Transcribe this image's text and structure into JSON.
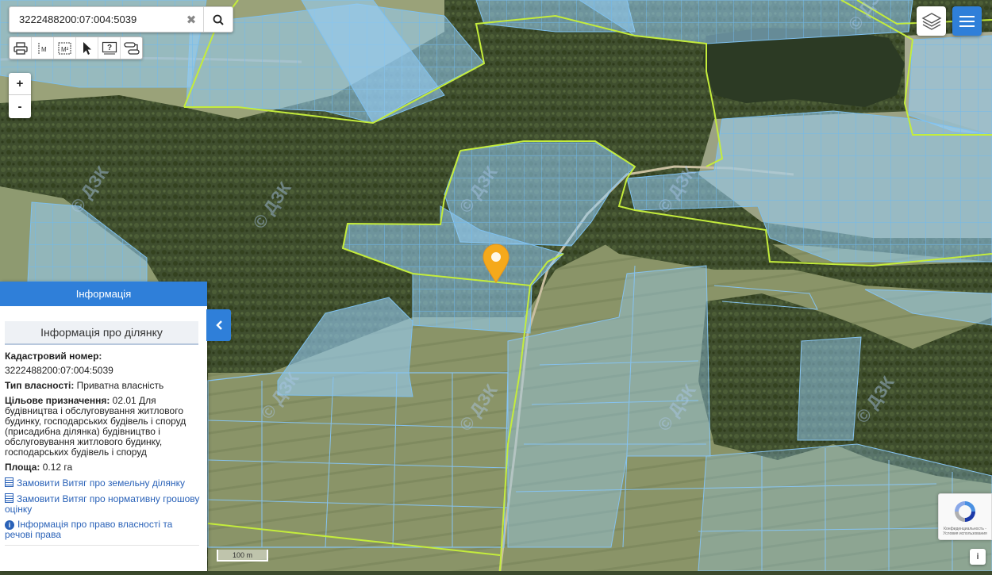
{
  "search": {
    "value": "3222488200:07:004:5039",
    "clear_icon": "close-icon",
    "search_icon": "search-icon"
  },
  "toolbar": {
    "tools": [
      "print-icon",
      "measure-length-icon",
      "measure-area-icon",
      "pointer-icon",
      "identify-icon",
      "route-icon"
    ],
    "tool_labels": [
      "M",
      "M²"
    ]
  },
  "zoom": {
    "in": "+",
    "out": "-"
  },
  "map": {
    "watermark": "© ДЗК",
    "scale": "100 m",
    "accent": "#2f7fd9",
    "parcel_fill": "#8ec5f2",
    "boundary": "#c4ec3c",
    "marker": "#f5a91b"
  },
  "panel": {
    "header": "Інформація",
    "subtitle": "Інформація про ділянку",
    "cadastral_label": "Кадастровий номер:",
    "cadastral_value": "3222488200:07:004:5039",
    "ownership_label": "Тип власності:",
    "ownership_value": " Приватна власність",
    "purpose_label": "Цільове призначення:",
    "purpose_value": " 02.01 Для будівництва і обслуговування житлового будинку, господарських будівель і споруд (присадибна ділянка) будівництво і обслуговування житлового будинку, господарських будівель і споруд",
    "area_label": "Площа:",
    "area_value": " 0.12 га",
    "link_extract": "Замовити Витяг про земельну ділянку",
    "link_valuation": "Замовити Витяг про нормативну грошову оцінку",
    "link_rights": "Інформація про право власності та речові права"
  },
  "captcha": {
    "text": "Конфиденциальность - Условия использования"
  },
  "info_button": "i"
}
